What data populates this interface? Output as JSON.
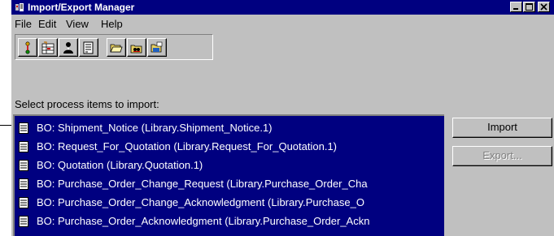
{
  "window": {
    "title": "Import/Export Manager"
  },
  "menu": [
    "File",
    "Edit",
    "View",
    "Help"
  ],
  "toolbar": {
    "buttons": [
      "route-icon",
      "import-grid-icon",
      "user-icon",
      "document-icon",
      "folder-open-icon",
      "mask-icon",
      "folder-export-icon"
    ]
  },
  "main": {
    "prompt": "Select process items to import:",
    "items": [
      "BO: Shipment_Notice  (Library.Shipment_Notice.1)",
      "BO: Request_For_Quotation  (Library.Request_For_Quotation.1)",
      "BO: Quotation  (Library.Quotation.1)",
      "BO: Purchase_Order_Change_Request  (Library.Purchase_Order_Cha",
      "BO: Purchase_Order_Change_Acknowledgment  (Library.Purchase_O",
      "BO: Purchase_Order_Acknowledgment  (Library.Purchase_Order_Ackn"
    ],
    "import_label": "Import",
    "export_label": "Export..."
  },
  "colors": {
    "title_bg": "#000080",
    "face": "#c0c0c0",
    "selection": "#000080"
  }
}
